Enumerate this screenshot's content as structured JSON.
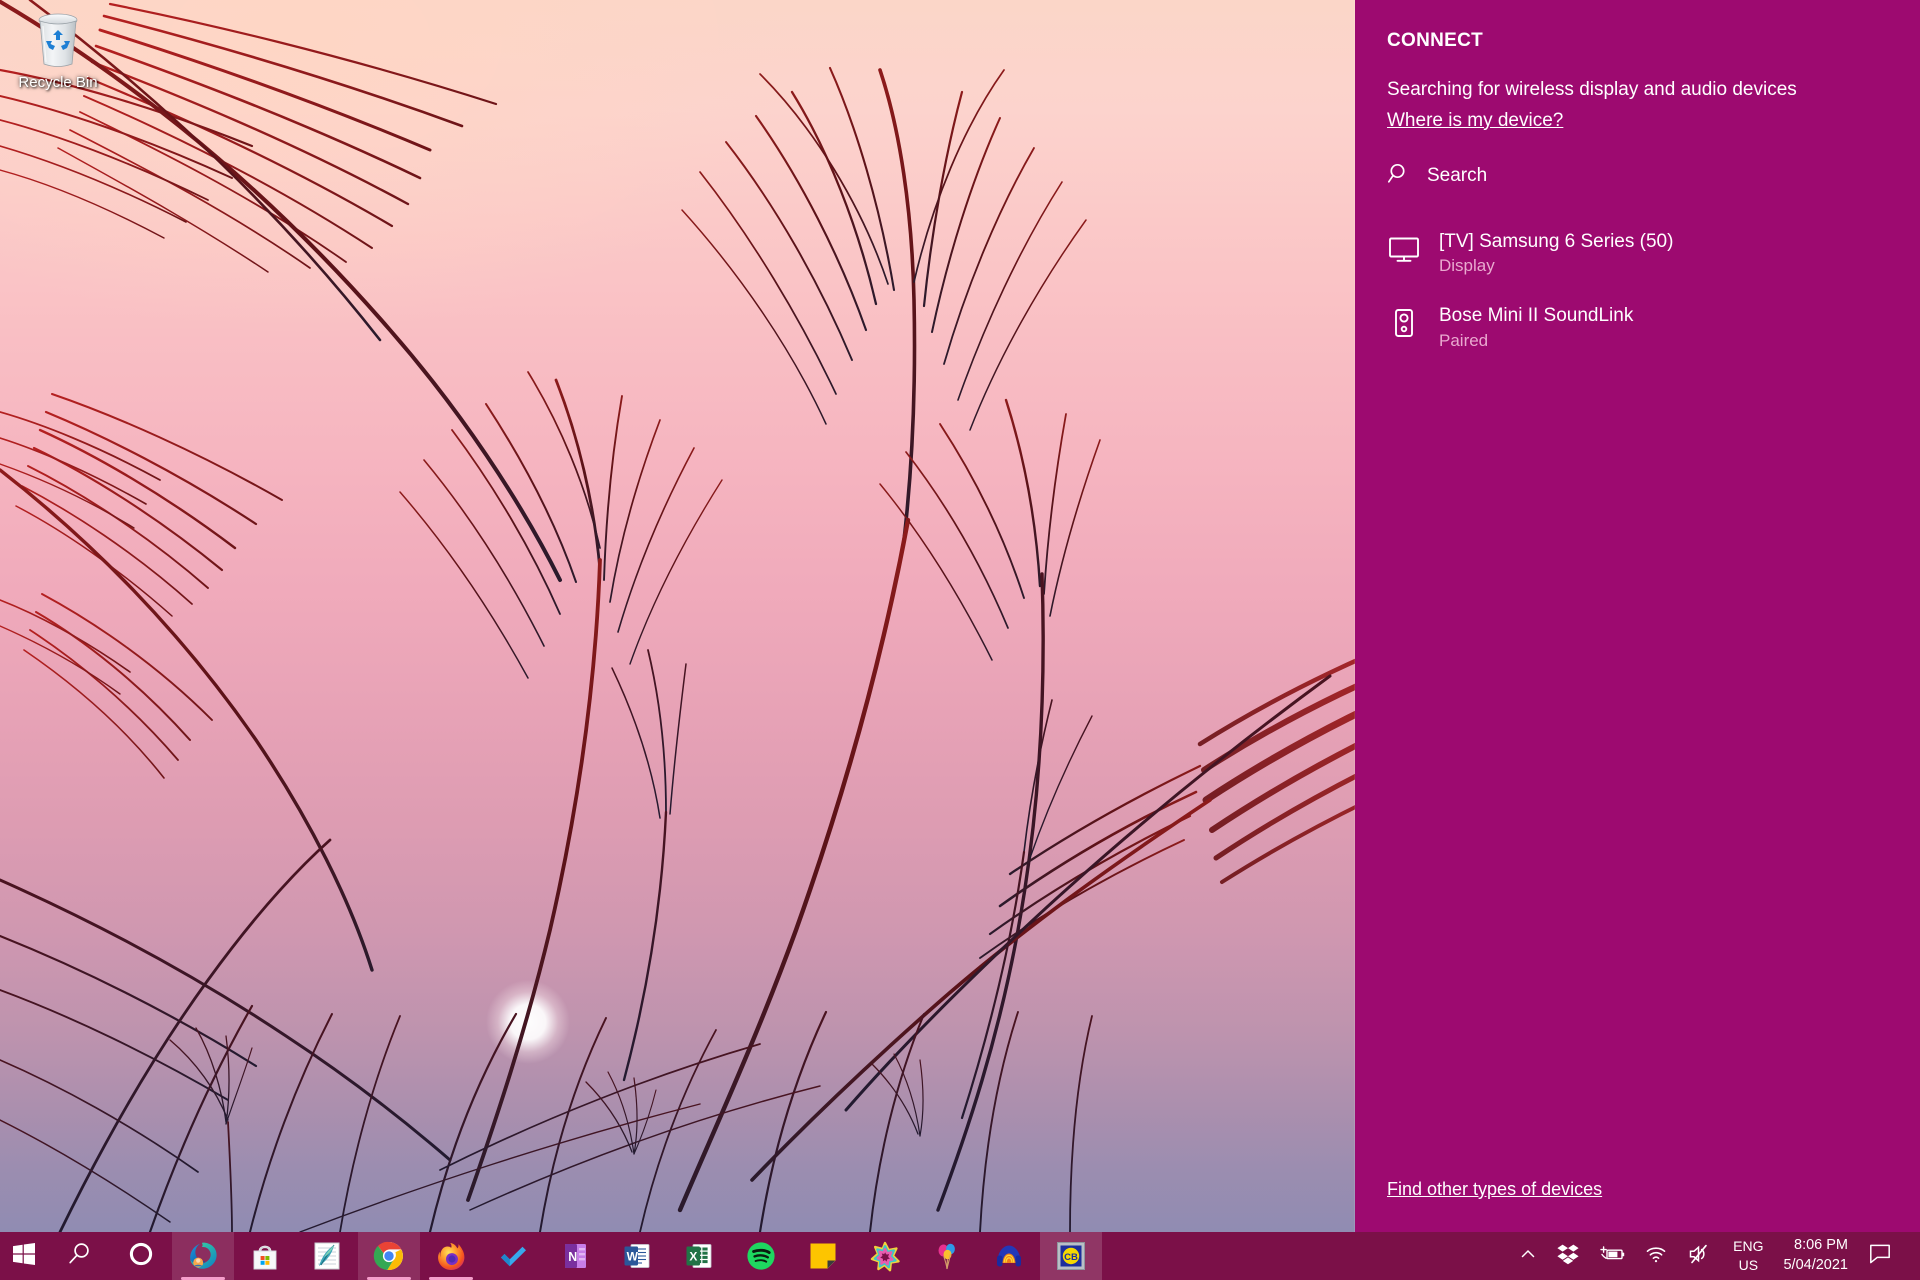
{
  "desktop": {
    "recycle_bin_label": "Recycle Bin",
    "recycle_bin_icon": "recycle-bin-icon"
  },
  "connect_panel": {
    "title": "CONNECT",
    "status_text": "Searching for wireless display and audio devices",
    "help_link": "Where is my device?",
    "search": {
      "label": "Search",
      "icon": "search-icon"
    },
    "devices": [
      {
        "name": "[TV] Samsung 6 Series (50)",
        "status": "Display",
        "icon": "monitor-icon"
      },
      {
        "name": "Bose Mini II SoundLink",
        "status": "Paired",
        "icon": "speaker-icon"
      }
    ],
    "footer_link": "Find other types of devices",
    "colors": {
      "panel_background": "#9d0a70",
      "text": "#ffffff",
      "subtext": "#e9a9cf"
    }
  },
  "taskbar": {
    "background_color": "#7b1048",
    "accent_underline": "#f59ecb",
    "items": [
      {
        "name": "start-button",
        "icon": "windows-logo-icon",
        "label": "Start",
        "running": false
      },
      {
        "name": "search-button",
        "icon": "search-icon",
        "label": "Search",
        "running": false
      },
      {
        "name": "cortana-button",
        "icon": "cortana-icon",
        "label": "Cortana",
        "running": false
      },
      {
        "name": "taskbar-app-edge",
        "icon": "edge-icon",
        "label": "Microsoft Edge",
        "running": true
      },
      {
        "name": "taskbar-app-store",
        "icon": "microsoft-store-icon",
        "label": "Microsoft Store",
        "running": false
      },
      {
        "name": "taskbar-app-feather",
        "icon": "feather-editor-icon",
        "label": "Editor",
        "running": false
      },
      {
        "name": "taskbar-app-chrome",
        "icon": "chrome-icon",
        "label": "Google Chrome",
        "running": true
      },
      {
        "name": "taskbar-app-firefox",
        "icon": "firefox-icon",
        "label": "Mozilla Firefox",
        "running": true
      },
      {
        "name": "taskbar-app-todoist",
        "icon": "checkmark-icon",
        "label": "Todoist",
        "running": false
      },
      {
        "name": "taskbar-app-onenote",
        "icon": "onenote-icon",
        "label": "OneNote",
        "running": false
      },
      {
        "name": "taskbar-app-word",
        "icon": "word-icon",
        "label": "Word",
        "running": false
      },
      {
        "name": "taskbar-app-excel",
        "icon": "excel-icon",
        "label": "Excel",
        "running": false
      },
      {
        "name": "taskbar-app-spotify",
        "icon": "spotify-icon",
        "label": "Spotify",
        "running": false
      },
      {
        "name": "taskbar-app-sticky-notes",
        "icon": "sticky-notes-icon",
        "label": "Sticky Notes",
        "running": false
      },
      {
        "name": "taskbar-app-burst",
        "icon": "star-burst-icon",
        "label": "Paint 3D",
        "running": false
      },
      {
        "name": "taskbar-app-balloons",
        "icon": "balloons-icon",
        "label": "Balloons",
        "running": false
      },
      {
        "name": "taskbar-app-headphones",
        "icon": "headphones-icon",
        "label": "Audio App",
        "running": false
      },
      {
        "name": "taskbar-app-cb",
        "icon": "cb-badge-icon",
        "label": "CB",
        "running": false
      }
    ],
    "tray": {
      "overflow_icon": "chevron-up-icon",
      "items": [
        {
          "name": "tray-dropbox",
          "icon": "dropbox-icon",
          "label": "Dropbox"
        },
        {
          "name": "tray-battery",
          "icon": "battery-charging-icon",
          "label": "Battery"
        },
        {
          "name": "tray-network",
          "icon": "wifi-icon",
          "label": "Network"
        },
        {
          "name": "tray-volume",
          "icon": "speaker-muted-icon",
          "label": "Volume"
        }
      ],
      "language": {
        "line1": "ENG",
        "line2": "US"
      },
      "clock": {
        "time": "8:06 PM",
        "date": "5/04/2021"
      },
      "action_center_icon": "action-center-icon"
    }
  }
}
